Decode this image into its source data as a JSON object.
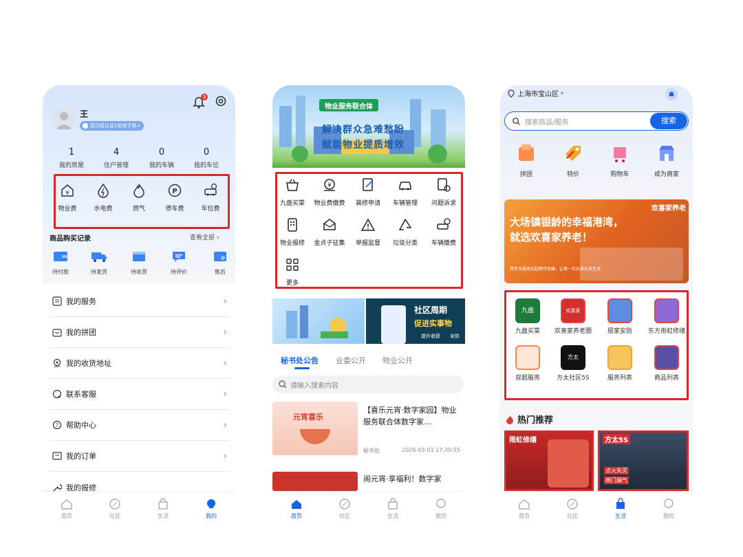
{
  "phone1": {
    "user_name": "王",
    "verify_badge": "您已经认证1处房子哟",
    "stats": [
      {
        "num": "1",
        "label": "我的房屋"
      },
      {
        "num": "4",
        "label": "住户管理"
      },
      {
        "num": "0",
        "label": "我的车辆"
      },
      {
        "num": "0",
        "label": "我的车位"
      }
    ],
    "services": [
      "物业费",
      "水电费",
      "燃气",
      "停车费",
      "车位费"
    ],
    "orders_title": "商品购买记录",
    "view_all": "查看全部",
    "orders": [
      "待付款",
      "待发货",
      "待收货",
      "待评价",
      "售后"
    ],
    "menu": [
      "我的服务",
      "我的拼团",
      "我的收货地址",
      "联系客服",
      "帮助中心",
      "我的订单",
      "我的报修"
    ],
    "bell_badge": "3",
    "tabs": [
      "首页",
      "社区",
      "生活",
      "我的"
    ]
  },
  "phone2": {
    "banner_tag": "物业服务联合体",
    "banner_line1": "解决群众急难愁盼",
    "banner_line2": "赋能物业提质增效",
    "grid": [
      "九盘买菜",
      "物业费缴费",
      "装修申请",
      "车辆管理",
      "问题诉求",
      "物业报修",
      "金点子征集",
      "举报监督",
      "垃圾分类",
      "车辆缴费",
      "更多"
    ],
    "promo_title": "社区周期",
    "promo_sub": "促进实事物",
    "promo_tags": [
      "提升收获",
      "安防"
    ],
    "news_tabs": [
      "秘书处公告",
      "业委公开",
      "物业公开"
    ],
    "search_placeholder": "请输入搜索内容",
    "news": [
      {
        "title": "【喜乐元宵·数字家园】物业服务联合体数字家…",
        "source": "秘书处",
        "time": "2026-03-03 17:30:55",
        "thumb_text": "元宵喜乐"
      },
      {
        "title": "闹元宵·享福利！数字家",
        "source": "",
        "time": "",
        "thumb_text": ""
      }
    ],
    "tabs": [
      "首页",
      "社区",
      "生活",
      "我的"
    ]
  },
  "phone3": {
    "location": "上海市宝山区",
    "search_placeholder": "搜索商品/服务",
    "search_button": "搜索",
    "quick": [
      "拼团",
      "特价",
      "购物车",
      "成为商家"
    ],
    "banner_tag": "欢喜家养老",
    "banner_line1": "大场镇银龄的幸福港湾，",
    "banner_line2": "就选欢喜家养老！",
    "banner_sub": "用专业服务托起晚年安康，让每一位长辈乐享生活",
    "services": [
      "九盘买菜",
      "欢喜家养老圈",
      "居家安防",
      "东方雨虹修缮",
      "双超服务",
      "方太社区5S",
      "服务列表",
      "商品列表"
    ],
    "service_tile_texts": [
      "九盘",
      "欢喜家",
      "",
      "",
      "",
      "方太",
      "",
      ""
    ],
    "hot_title": "热门推荐",
    "hot_cards": [
      "雨虹修缮",
      "方太5S"
    ],
    "hot_tags": [
      "点火失灵",
      "闸门漏气"
    ],
    "tabs": [
      "首页",
      "社区",
      "生活",
      "我的"
    ]
  },
  "colors": {
    "accent": "#1765e6",
    "red": "#d8282b"
  }
}
